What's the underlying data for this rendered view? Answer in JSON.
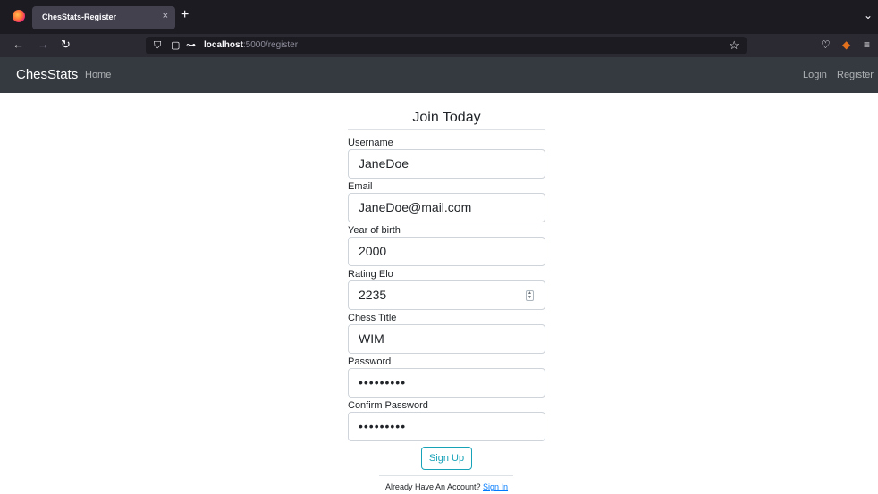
{
  "browser": {
    "tab_title": "ChesStats-Register",
    "tab_close": "×",
    "new_tab": "+",
    "tab_list": "⌄",
    "url_host": "localhost",
    "url_path": ":5000/register"
  },
  "navbar": {
    "brand": "ChesStats",
    "home": "Home",
    "login": "Login",
    "register": "Register"
  },
  "form": {
    "title": "Join Today",
    "fields": [
      {
        "label": "Username",
        "value": "JaneDoe"
      },
      {
        "label": "Email",
        "value": "JaneDoe@mail.com"
      },
      {
        "label": "Year of birth",
        "value": "2000"
      },
      {
        "label": "Rating Elo",
        "value": "2235"
      },
      {
        "label": "Chess Title",
        "value": "WIM"
      },
      {
        "label": "Password",
        "value": "•••••••••"
      },
      {
        "label": "Confirm Password",
        "value": "•••••••••"
      }
    ],
    "submit": "Sign Up",
    "footer_text": "Already Have An Account? ",
    "footer_link": "Sign In"
  },
  "colors": {
    "navbar_bg": "#343a40",
    "accent_info": "#17a2b8",
    "link": "#007bff"
  }
}
